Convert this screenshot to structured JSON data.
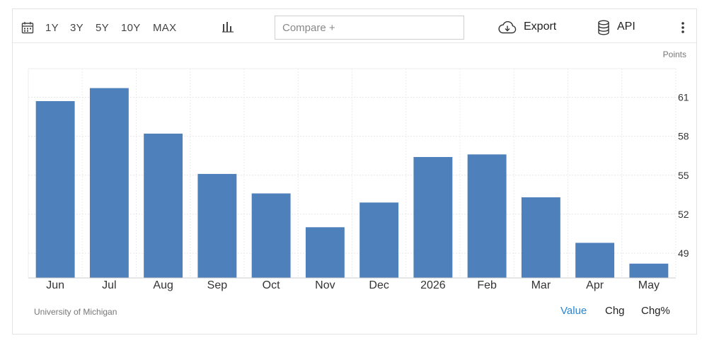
{
  "toolbar": {
    "ranges": [
      "1Y",
      "3Y",
      "5Y",
      "10Y",
      "MAX"
    ],
    "compare_placeholder": "Compare +",
    "export_label": "Export",
    "api_label": "API"
  },
  "footer": {
    "source": "University of Michigan",
    "tabs": [
      "Value",
      "Chg",
      "Chg%"
    ],
    "active_tab": "Value"
  },
  "colors": {
    "bar": "#4e80bb",
    "active_tab": "#2a86d1"
  },
  "chart_data": {
    "type": "bar",
    "unit_label": "Points",
    "categories": [
      "Jun",
      "Jul",
      "Aug",
      "Sep",
      "Oct",
      "Nov",
      "Dec",
      "2026",
      "Feb",
      "Mar",
      "Apr",
      "May"
    ],
    "values": [
      60.7,
      61.7,
      58.2,
      55.1,
      53.6,
      51.0,
      52.9,
      56.4,
      56.6,
      53.3,
      49.8,
      48.2
    ],
    "yticks": [
      49,
      52,
      55,
      58,
      61
    ],
    "ylim": [
      47.1,
      63.2
    ],
    "y_axis_position": "right",
    "grid": true
  }
}
